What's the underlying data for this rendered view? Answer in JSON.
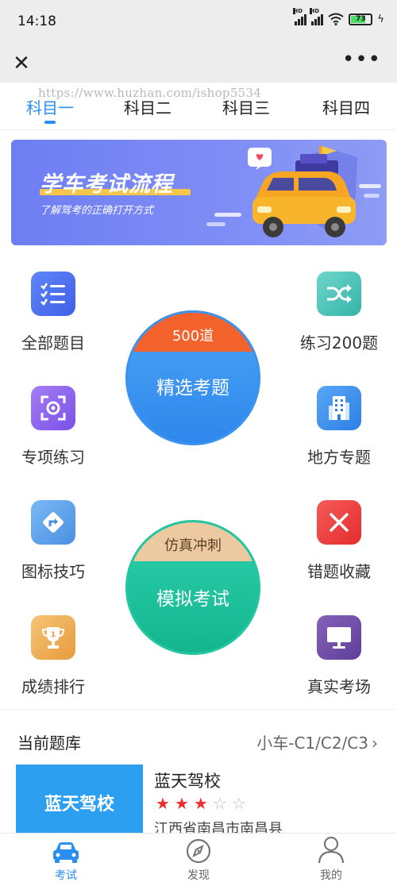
{
  "status_bar": {
    "time": "14:18",
    "battery": "73",
    "hd1": "HD",
    "hd2": "HD"
  },
  "tabs": [
    {
      "label": "科目一",
      "active": true
    },
    {
      "label": "科目二",
      "active": false
    },
    {
      "label": "科目三",
      "active": false
    },
    {
      "label": "科目四",
      "active": false
    }
  ],
  "watermark": "https://www.huzhan.com/ishop5534",
  "banner": {
    "title": "学车考试流程",
    "subtitle": "了解驾考的正确打开方式"
  },
  "features": {
    "all_questions": "全部题目",
    "practice_200": "练习200题",
    "special_practice": "专项练习",
    "local_topics": "地方专题",
    "sign_tips": "图标技巧",
    "mistakes": "错题收藏",
    "ranking": "成绩排行",
    "real_exam": "真实考场"
  },
  "selected_questions": {
    "count": "500道",
    "label": "精选考题"
  },
  "mock_exam": {
    "cap": "仿真冲刺",
    "label": "模拟考试"
  },
  "question_bank": {
    "title": "当前题库",
    "value": "小车-C1/C2/C3"
  },
  "school": {
    "card": "蓝天驾校",
    "name": "蓝天驾校",
    "rating": 3,
    "max_rating": 5,
    "address": "江西省南昌市南昌县"
  },
  "bottom_nav": [
    {
      "label": "考试",
      "icon": "car-icon",
      "active": true
    },
    {
      "label": "发现",
      "icon": "compass-icon",
      "active": false
    },
    {
      "label": "我的",
      "icon": "user-icon",
      "active": false
    }
  ],
  "colors": {
    "accent": "#2a8df0",
    "star": "#ee2d2d",
    "banner": "#7584f3"
  }
}
